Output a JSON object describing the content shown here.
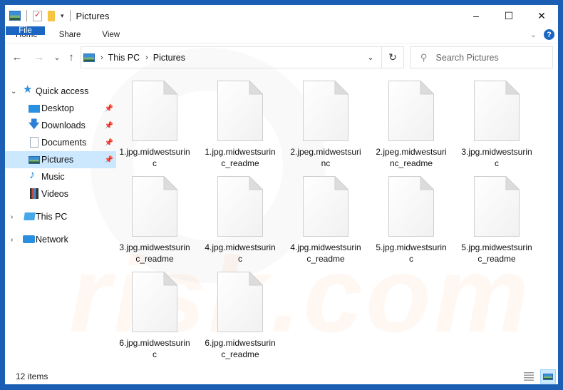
{
  "window": {
    "title": "Pictures",
    "controls": {
      "minimize": "–",
      "maximize": "☐",
      "close": "✕"
    }
  },
  "quick_access_toolbar": {
    "icons": [
      "pictures-icon",
      "properties-icon",
      "new-folder-icon"
    ],
    "customize_glyph": "▾"
  },
  "ribbon": {
    "tabs": [
      {
        "label": "File",
        "active": true
      },
      {
        "label": "Home"
      },
      {
        "label": "Share"
      },
      {
        "label": "View"
      }
    ],
    "expand_glyph": "⌄",
    "help_glyph": "?"
  },
  "navigation": {
    "back_glyph": "←",
    "forward_glyph": "→",
    "recent_glyph": "⌄",
    "up_glyph": "↑",
    "breadcrumb": [
      "This PC",
      "Pictures"
    ],
    "crumb_sep": "›",
    "address_dropdown_glyph": "⌄",
    "refresh_glyph": "↻",
    "search": {
      "placeholder": "Search Pictures",
      "value": "",
      "icon_glyph": "⚲"
    }
  },
  "sidebar": {
    "items": [
      {
        "label": "Quick access",
        "icon": "star-icon",
        "glyph": "★",
        "caret": "⌄",
        "level": 0
      },
      {
        "label": "Desktop",
        "icon": "desktop-icon",
        "pinned": true,
        "level": 1
      },
      {
        "label": "Downloads",
        "icon": "download-icon",
        "glyph": "🡇",
        "pinned": true,
        "level": 1
      },
      {
        "label": "Documents",
        "icon": "documents-icon",
        "pinned": true,
        "level": 1
      },
      {
        "label": "Pictures",
        "icon": "pictures-icon",
        "pinned": true,
        "selected": true,
        "level": 1
      },
      {
        "label": "Music",
        "icon": "music-icon",
        "glyph": "♪",
        "level": 1
      },
      {
        "label": "Videos",
        "icon": "videos-icon",
        "level": 1
      },
      {
        "label": "This PC",
        "icon": "this-pc-icon",
        "caret": "›",
        "level": 0
      },
      {
        "label": "Network",
        "icon": "network-icon",
        "caret": "›",
        "level": 0
      }
    ],
    "pin_glyph": "📌"
  },
  "files": [
    {
      "name": "1.jpg.midwestsurinc"
    },
    {
      "name": "1.jpg.midwestsurinc_readme"
    },
    {
      "name": "2.jpeg.midwestsurinc"
    },
    {
      "name": "2.jpeg.midwestsurinc_readme"
    },
    {
      "name": "3.jpg.midwestsurinc"
    },
    {
      "name": "3.jpg.midwestsurinc_readme"
    },
    {
      "name": "4.jpg.midwestsurinc"
    },
    {
      "name": "4.jpg.midwestsurinc_readme"
    },
    {
      "name": "5.jpg.midwestsurinc"
    },
    {
      "name": "5.jpg.midwestsurinc_readme"
    },
    {
      "name": "6.jpg.midwestsurinc"
    },
    {
      "name": "6.jpg.midwestsurinc_readme"
    }
  ],
  "status_bar": {
    "item_count": "12 items",
    "views": [
      "details-view",
      "large-icons-view"
    ],
    "active_view": "large-icons-view"
  },
  "watermark": {
    "text": "risk.com"
  },
  "colors": {
    "window_border": "#1a5fb4",
    "file_tab": "#1a66c2",
    "selection": "#cce8ff",
    "accent_icon": "#2b8fe0"
  }
}
